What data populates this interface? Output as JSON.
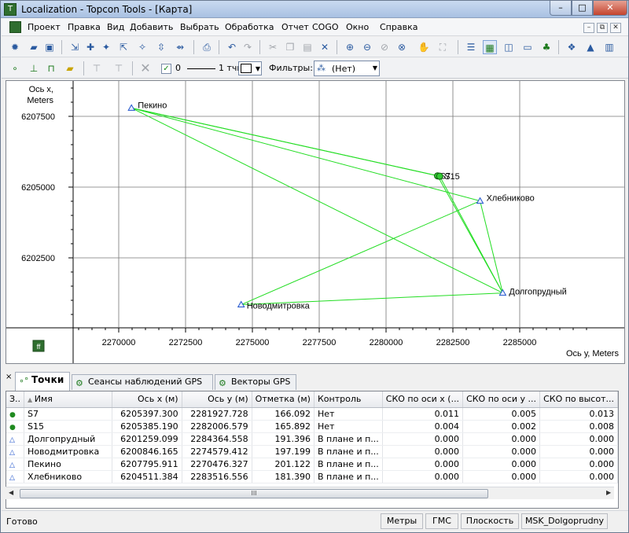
{
  "window": {
    "title": "Localization - Topcon Tools - [Карта]",
    "minimize": "–",
    "maximize": "□",
    "close": "✕"
  },
  "menu": {
    "items": [
      "Проект",
      "Правка",
      "Вид",
      "Добавить",
      "Выбрать",
      "Обработка",
      "Отчет",
      "COGO",
      "Окно",
      "Справка"
    ],
    "mdi_min": "–",
    "mdi_restore": "⧉",
    "mdi_close": "✕"
  },
  "toolbar2": {
    "line_checked": true,
    "line_value": "0",
    "line_weight": "1 тчк",
    "filter_label": "Фильтры:",
    "filter_value": "(Нет)"
  },
  "map": {
    "y_axis_title_line1": "Ось x,",
    "y_axis_title_line2": "Meters",
    "y_ticks": [
      "6207500",
      "6205000",
      "6202500"
    ],
    "x_ticks": [
      "2270000",
      "2272500",
      "2275000",
      "2277500",
      "2280000",
      "2282500",
      "2285000"
    ],
    "x_axis_title": "Ось у, Meters",
    "points": [
      {
        "name": "Пекино",
        "label": "Пекино",
        "x": 2270476.327,
        "y": 6207795.911,
        "symbol": "triangle"
      },
      {
        "name": "Хлебниково",
        "label": "Хлебниково",
        "x": 2283516.556,
        "y": 6204511.384,
        "symbol": "triangle"
      },
      {
        "name": "Долгопрудный",
        "label": "Долгопрудный",
        "x": 2284364.558,
        "y": 6201259.099,
        "symbol": "triangle"
      },
      {
        "name": "Новодмитровка",
        "label": "Новодмитровка",
        "x": 2274579.412,
        "y": 6200846.165,
        "symbol": "triangle"
      },
      {
        "name": "S7",
        "label": "S7",
        "x": 2281927.728,
        "y": 6205397.3,
        "symbol": "circle"
      },
      {
        "name": "S15",
        "label": "S15",
        "x": 2282006.579,
        "y": 6205385.19,
        "symbol": "circle"
      }
    ],
    "vectors": [
      [
        "Пекино",
        "S7"
      ],
      [
        "Пекино",
        "S15"
      ],
      [
        "Пекино",
        "Хлебниково"
      ],
      [
        "Пекино",
        "Долгопрудный"
      ],
      [
        "S7",
        "Долгопрудный"
      ],
      [
        "S15",
        "Долгопрудный"
      ],
      [
        "Хлебниково",
        "Долгопрудный"
      ],
      [
        "Хлебниково",
        "Новодмитровка"
      ],
      [
        "Новодмитровка",
        "Долгопрудный"
      ]
    ],
    "line_color": "#22dd22"
  },
  "panel": {
    "close": "×",
    "tabs": [
      "Точки",
      "Сеансы наблюдений GPS",
      "Векторы GPS"
    ],
    "columns": [
      "З..",
      "Имя",
      "Ось х (м)",
      "Ось у (м)",
      "Отметка (м)",
      "Контроль",
      "СКО по оси х (...",
      "СКО по оси у ...",
      "СКО по высот..."
    ],
    "rows": [
      {
        "icon": "circle",
        "name": "S7",
        "x": "6205397.300",
        "y": "2281927.728",
        "h": "166.092",
        "ctrl": "Нет",
        "sx": "0.011",
        "sy": "0.005",
        "sh": "0.013"
      },
      {
        "icon": "circle",
        "name": "S15",
        "x": "6205385.190",
        "y": "2282006.579",
        "h": "165.892",
        "ctrl": "Нет",
        "sx": "0.004",
        "sy": "0.002",
        "sh": "0.008"
      },
      {
        "icon": "triangle",
        "name": "Долгопрудный",
        "x": "6201259.099",
        "y": "2284364.558",
        "h": "191.396",
        "ctrl": "В плане и п...",
        "sx": "0.000",
        "sy": "0.000",
        "sh": "0.000"
      },
      {
        "icon": "triangle",
        "name": "Новодмитровка",
        "x": "6200846.165",
        "y": "2274579.412",
        "h": "197.199",
        "ctrl": "В плане и п...",
        "sx": "0.000",
        "sy": "0.000",
        "sh": "0.000"
      },
      {
        "icon": "triangle",
        "name": "Пекино",
        "x": "6207795.911",
        "y": "2270476.327",
        "h": "201.122",
        "ctrl": "В плане и п...",
        "sx": "0.000",
        "sy": "0.000",
        "sh": "0.000"
      },
      {
        "icon": "triangle",
        "name": "Хлебниково",
        "x": "6204511.384",
        "y": "2283516.556",
        "h": "181.390",
        "ctrl": "В плане и п...",
        "sx": "0.000",
        "sy": "0.000",
        "sh": "0.000"
      }
    ],
    "scroll_grip": "III"
  },
  "status": {
    "text": "Готово",
    "panes": [
      "Метры",
      "ГМС",
      "Плоскость",
      "MSK_Dolgoprudny"
    ]
  }
}
